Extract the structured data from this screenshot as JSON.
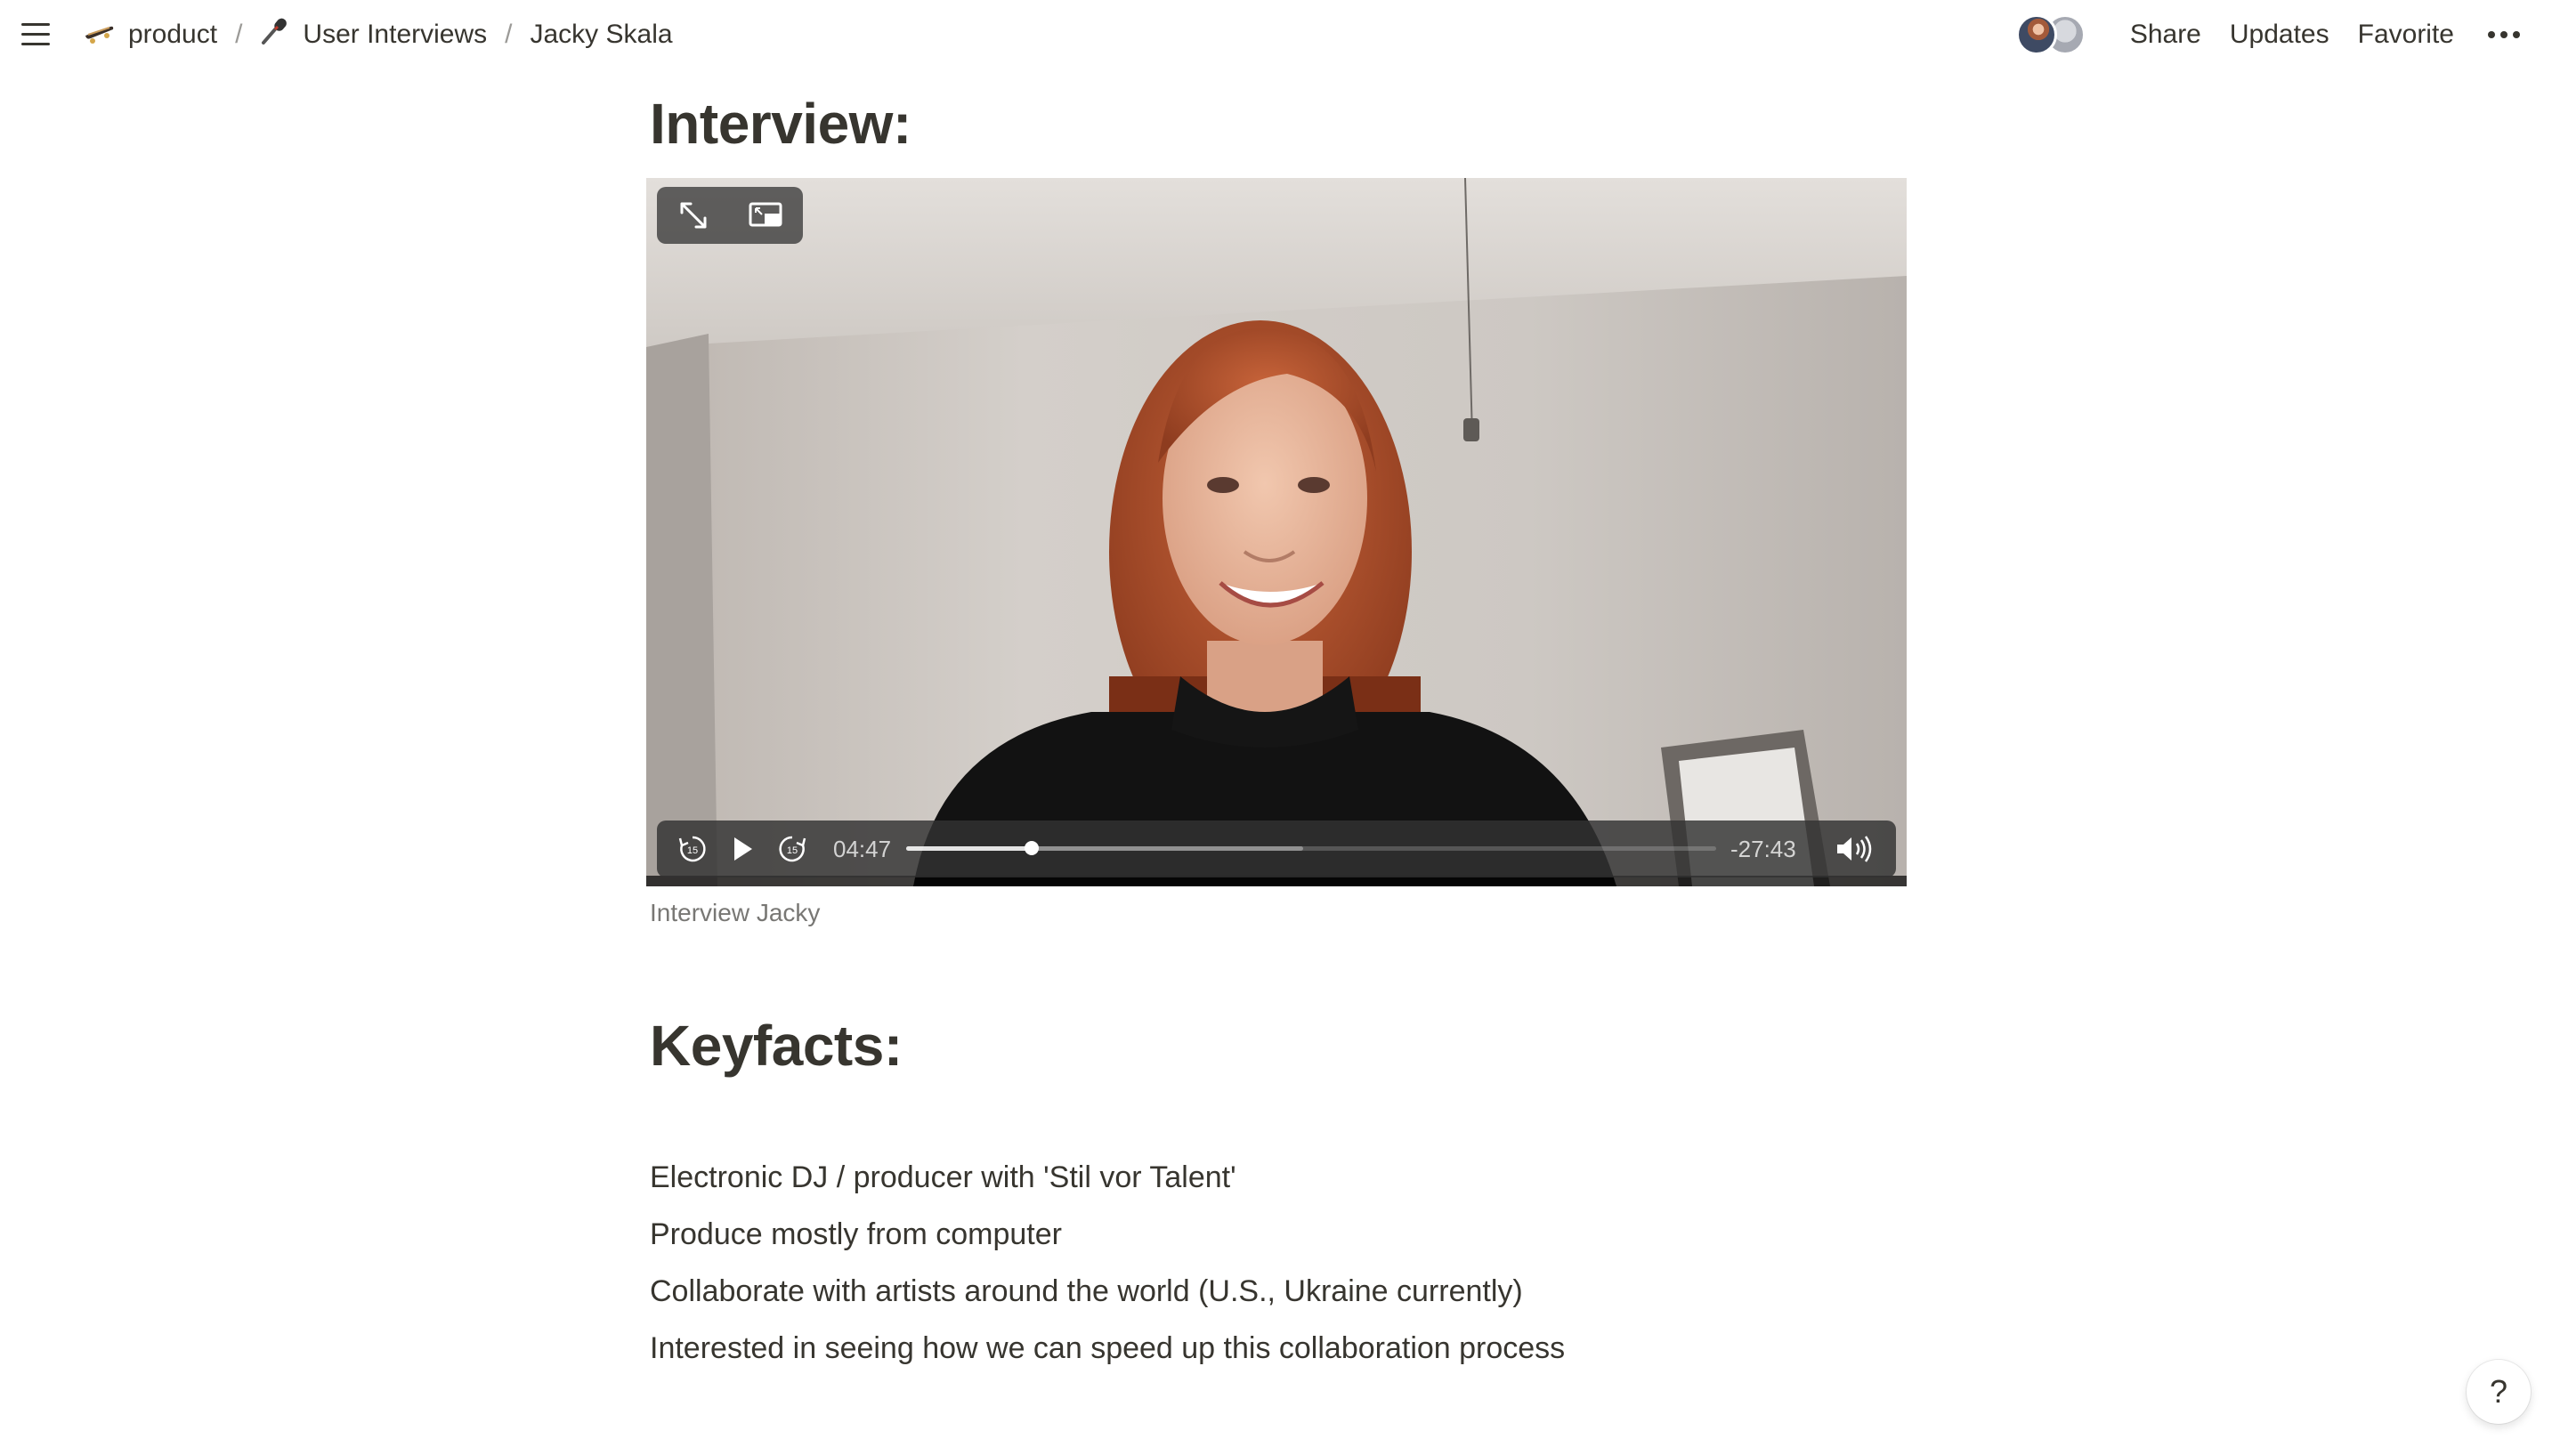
{
  "breadcrumb": {
    "items": [
      {
        "icon": "skateboard-icon",
        "label": "product"
      },
      {
        "icon": "microphone-icon",
        "label": "User Interviews"
      },
      {
        "icon": "",
        "label": "Jacky Skala"
      }
    ],
    "separator": "/"
  },
  "header_actions": {
    "share": "Share",
    "updates": "Updates",
    "favorite": "Favorite"
  },
  "page": {
    "heading_interview": "Interview:",
    "video": {
      "current_time": "04:47",
      "remaining_time": "-27:43",
      "progress": 0.155,
      "buffered": 0.49,
      "caption": "Interview Jacky"
    },
    "heading_keyfacts": "Keyfacts:",
    "keyfacts": [
      "Electronic DJ / producer with 'Stil vor Talent'",
      "Produce mostly from computer",
      "Collaborate with artists around the world (U.S., Ukraine currently)",
      "Interested in seeing how we can speed up this collaboration process"
    ]
  },
  "help": {
    "label": "?"
  }
}
